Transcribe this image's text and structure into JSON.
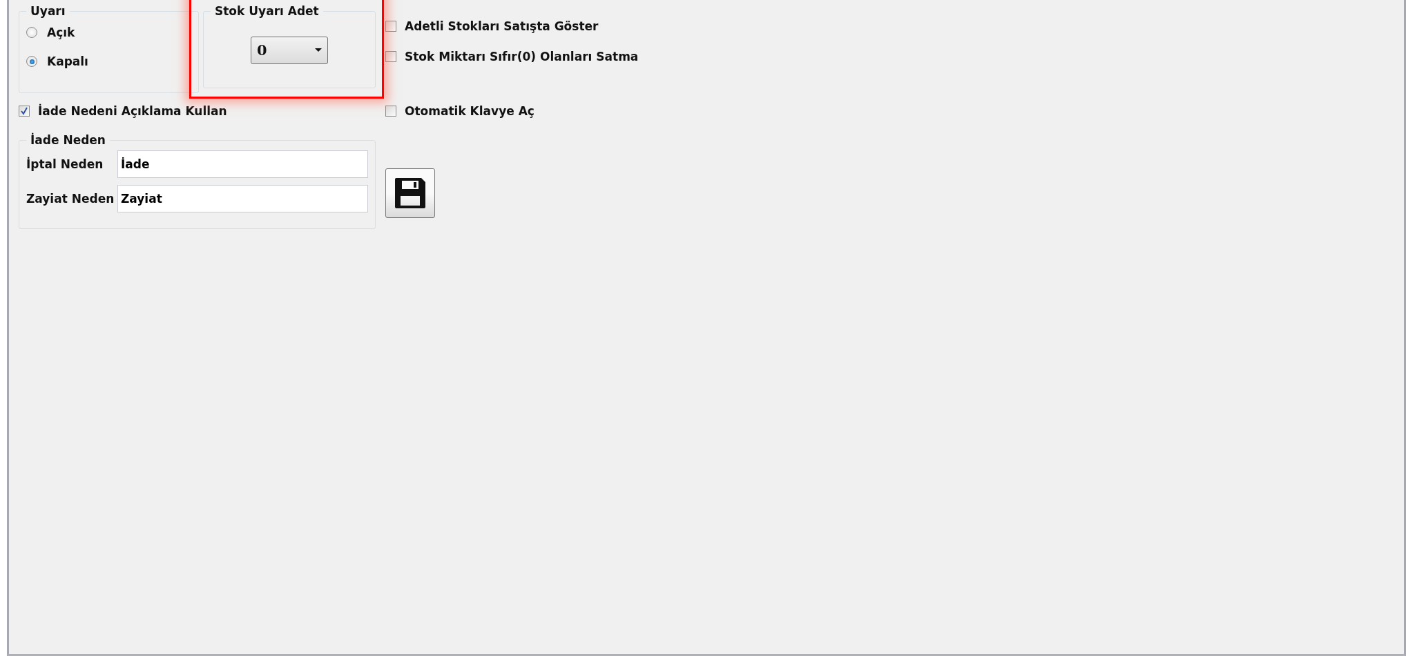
{
  "warning_group": {
    "title": "Uyarı",
    "options": [
      {
        "label": "Açık",
        "selected": false
      },
      {
        "label": "Kapalı",
        "selected": true
      }
    ]
  },
  "stock_warning": {
    "title": "Stok Uyarı Adet",
    "value": "0",
    "highlighted": true
  },
  "options_right": [
    {
      "label": "Adetli Stokları Satışta Göster",
      "checked": false
    },
    {
      "label": "Stok Miktarı Sıfır(0) Olanları Satma",
      "checked": false
    }
  ],
  "return_reason_checkbox": {
    "label": "İade Nedeni Açıklama Kullan",
    "checked": true
  },
  "auto_keyboard": {
    "label": "Otomatik Klavye Aç",
    "checked": false
  },
  "reason_group": {
    "title": "İade Neden",
    "fields": [
      {
        "label": "İptal Neden",
        "value": "İade"
      },
      {
        "label": "Zayiat Neden",
        "value": "Zayiat"
      }
    ]
  }
}
